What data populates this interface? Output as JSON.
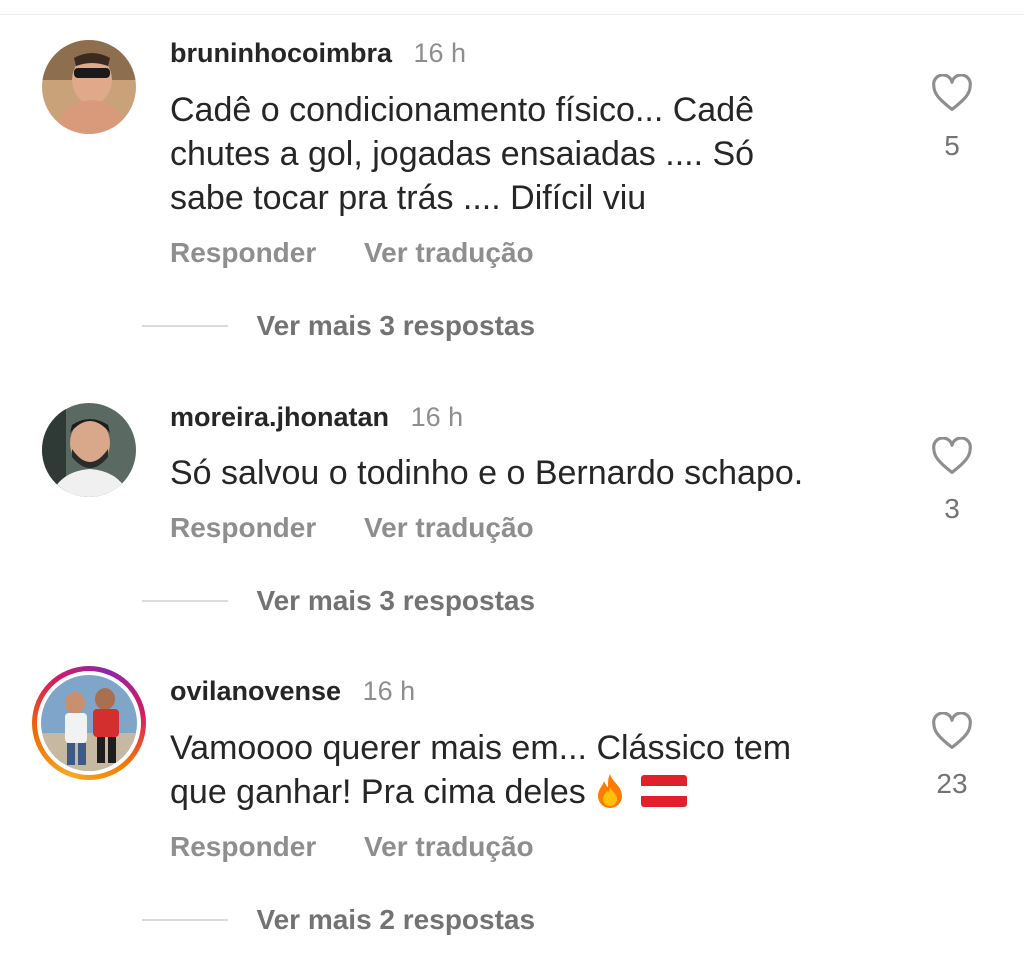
{
  "comments": [
    {
      "username": "bruninhocoimbra",
      "time": "16 h",
      "text_lines": [
        "Cadê o condicionamento físico... Cadê",
        "chutes a gol, jogadas ensaiadas .... Só",
        "sabe tocar pra trás .... Difícil viu"
      ],
      "reply_label": "Responder",
      "translate_label": "Ver tradução",
      "likes": "5",
      "more_replies": "Ver mais 3 respostas",
      "has_story_ring": false
    },
    {
      "username": "moreira.jhonatan",
      "time": "16 h",
      "text_lines": [
        "Só salvou o todinho e o Bernardo schapo."
      ],
      "reply_label": "Responder",
      "translate_label": "Ver tradução",
      "likes": "3",
      "more_replies": "Ver mais 3 respostas",
      "has_story_ring": false
    },
    {
      "username": "ovilanovense",
      "time": "16 h",
      "text_lines": [
        "Vamoooo querer mais em... Clássico tem",
        "que ganhar! Pra cima deles"
      ],
      "emoji": [
        "fire-emoji",
        "austria-flag-emoji"
      ],
      "reply_label": "Responder",
      "translate_label": "Ver tradução",
      "likes": "23",
      "more_replies": "Ver mais 2 respostas",
      "has_story_ring": true
    }
  ],
  "colors": {
    "text": "#262626",
    "secondary": "#8e8e8e",
    "divider": "#dbdbdb",
    "flag_red": "#e0202a"
  },
  "icons": {
    "like": "heart-outline-icon"
  }
}
